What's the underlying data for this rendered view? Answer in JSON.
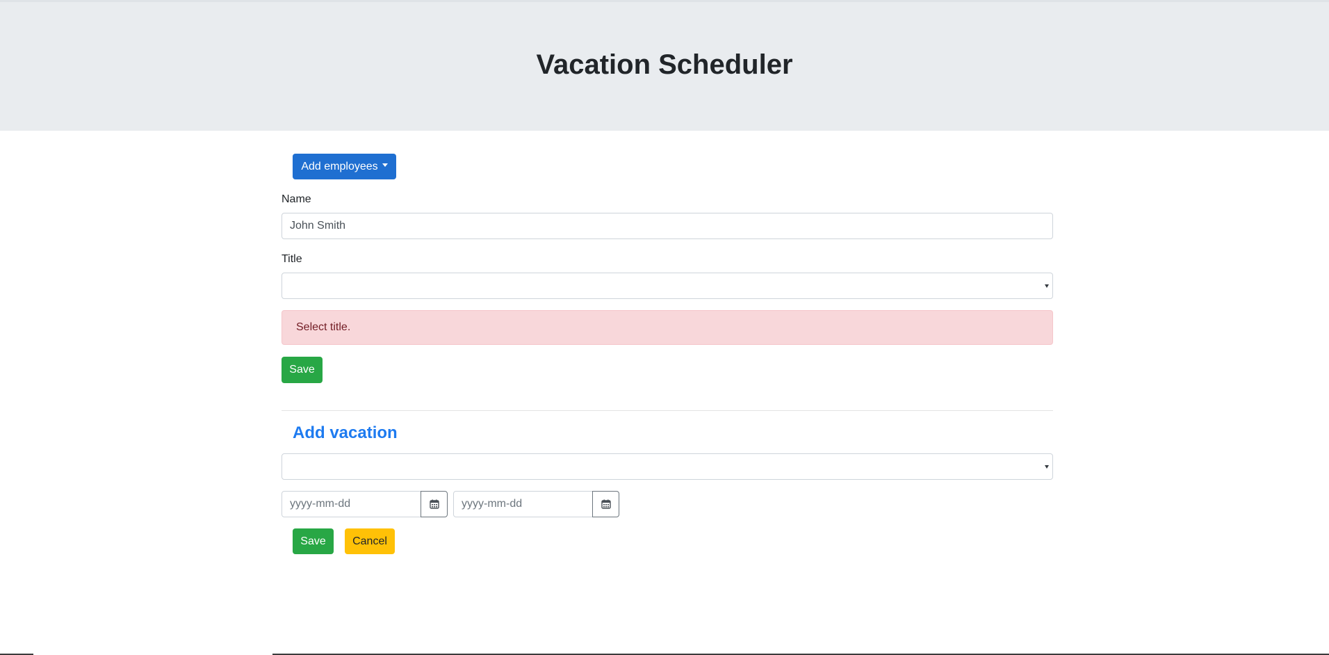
{
  "header": {
    "title": "Vacation Scheduler"
  },
  "employee_form": {
    "add_employees_label": "Add employees",
    "name_label": "Name",
    "name_value": "John Smith",
    "title_label": "Title",
    "title_value": "",
    "alert_text": "Select title.",
    "save_label": "Save"
  },
  "vacation_form": {
    "section_title": "Add vacation",
    "employee_select_value": "",
    "start_date_placeholder": "yyyy-mm-dd",
    "end_date_placeholder": "yyyy-mm-dd",
    "save_label": "Save",
    "cancel_label": "Cancel"
  },
  "icons": {
    "dropdown": "chevron-down-icon",
    "calendar": "calendar-icon"
  },
  "colors": {
    "primary": "#1f6fd1",
    "success": "#28a745",
    "warning": "#ffc107",
    "danger_bg": "#f8d7da",
    "link": "#1e7bf0",
    "jumbotron": "#e9ecef"
  }
}
